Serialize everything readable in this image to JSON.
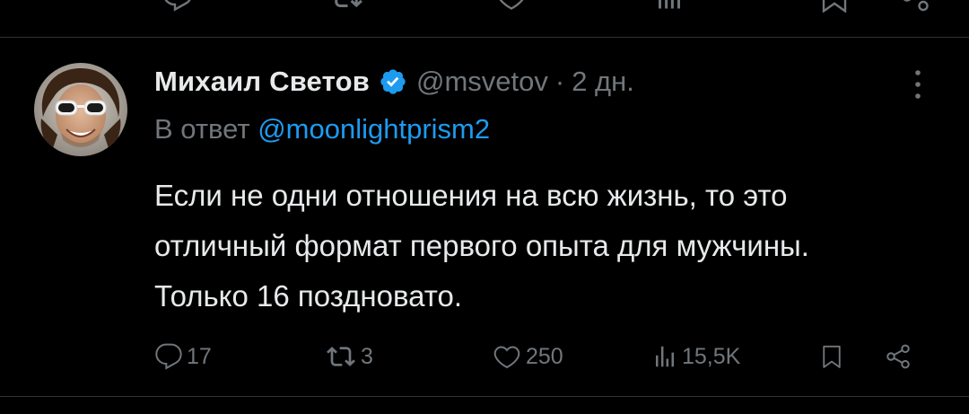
{
  "tweet": {
    "author_name": "Михаил Светов",
    "handle": "@msvetov",
    "separator": "·",
    "time": "2 дн.",
    "reply_prefix": "В ответ",
    "reply_mention": "@moonlightprism2",
    "text": "Если не одни отношения на всю жизнь, то это отличный формат первого опыта для мужчины. Только 16 поздновато."
  },
  "actions": {
    "replies": "17",
    "retweets": "3",
    "likes": "250",
    "views": "15,5K"
  },
  "icons": {
    "reply": "reply-icon",
    "retweet": "retweet-icon",
    "like": "heart-icon",
    "views": "views-icon",
    "bookmark": "bookmark-icon",
    "share": "share-icon",
    "more": "more-vertical-icon",
    "verified": "verified-badge-icon"
  },
  "colors": {
    "background": "#000000",
    "text": "#e7e9ea",
    "secondary": "#71767b",
    "accent": "#1d9bf0",
    "divider": "#2f3336"
  }
}
